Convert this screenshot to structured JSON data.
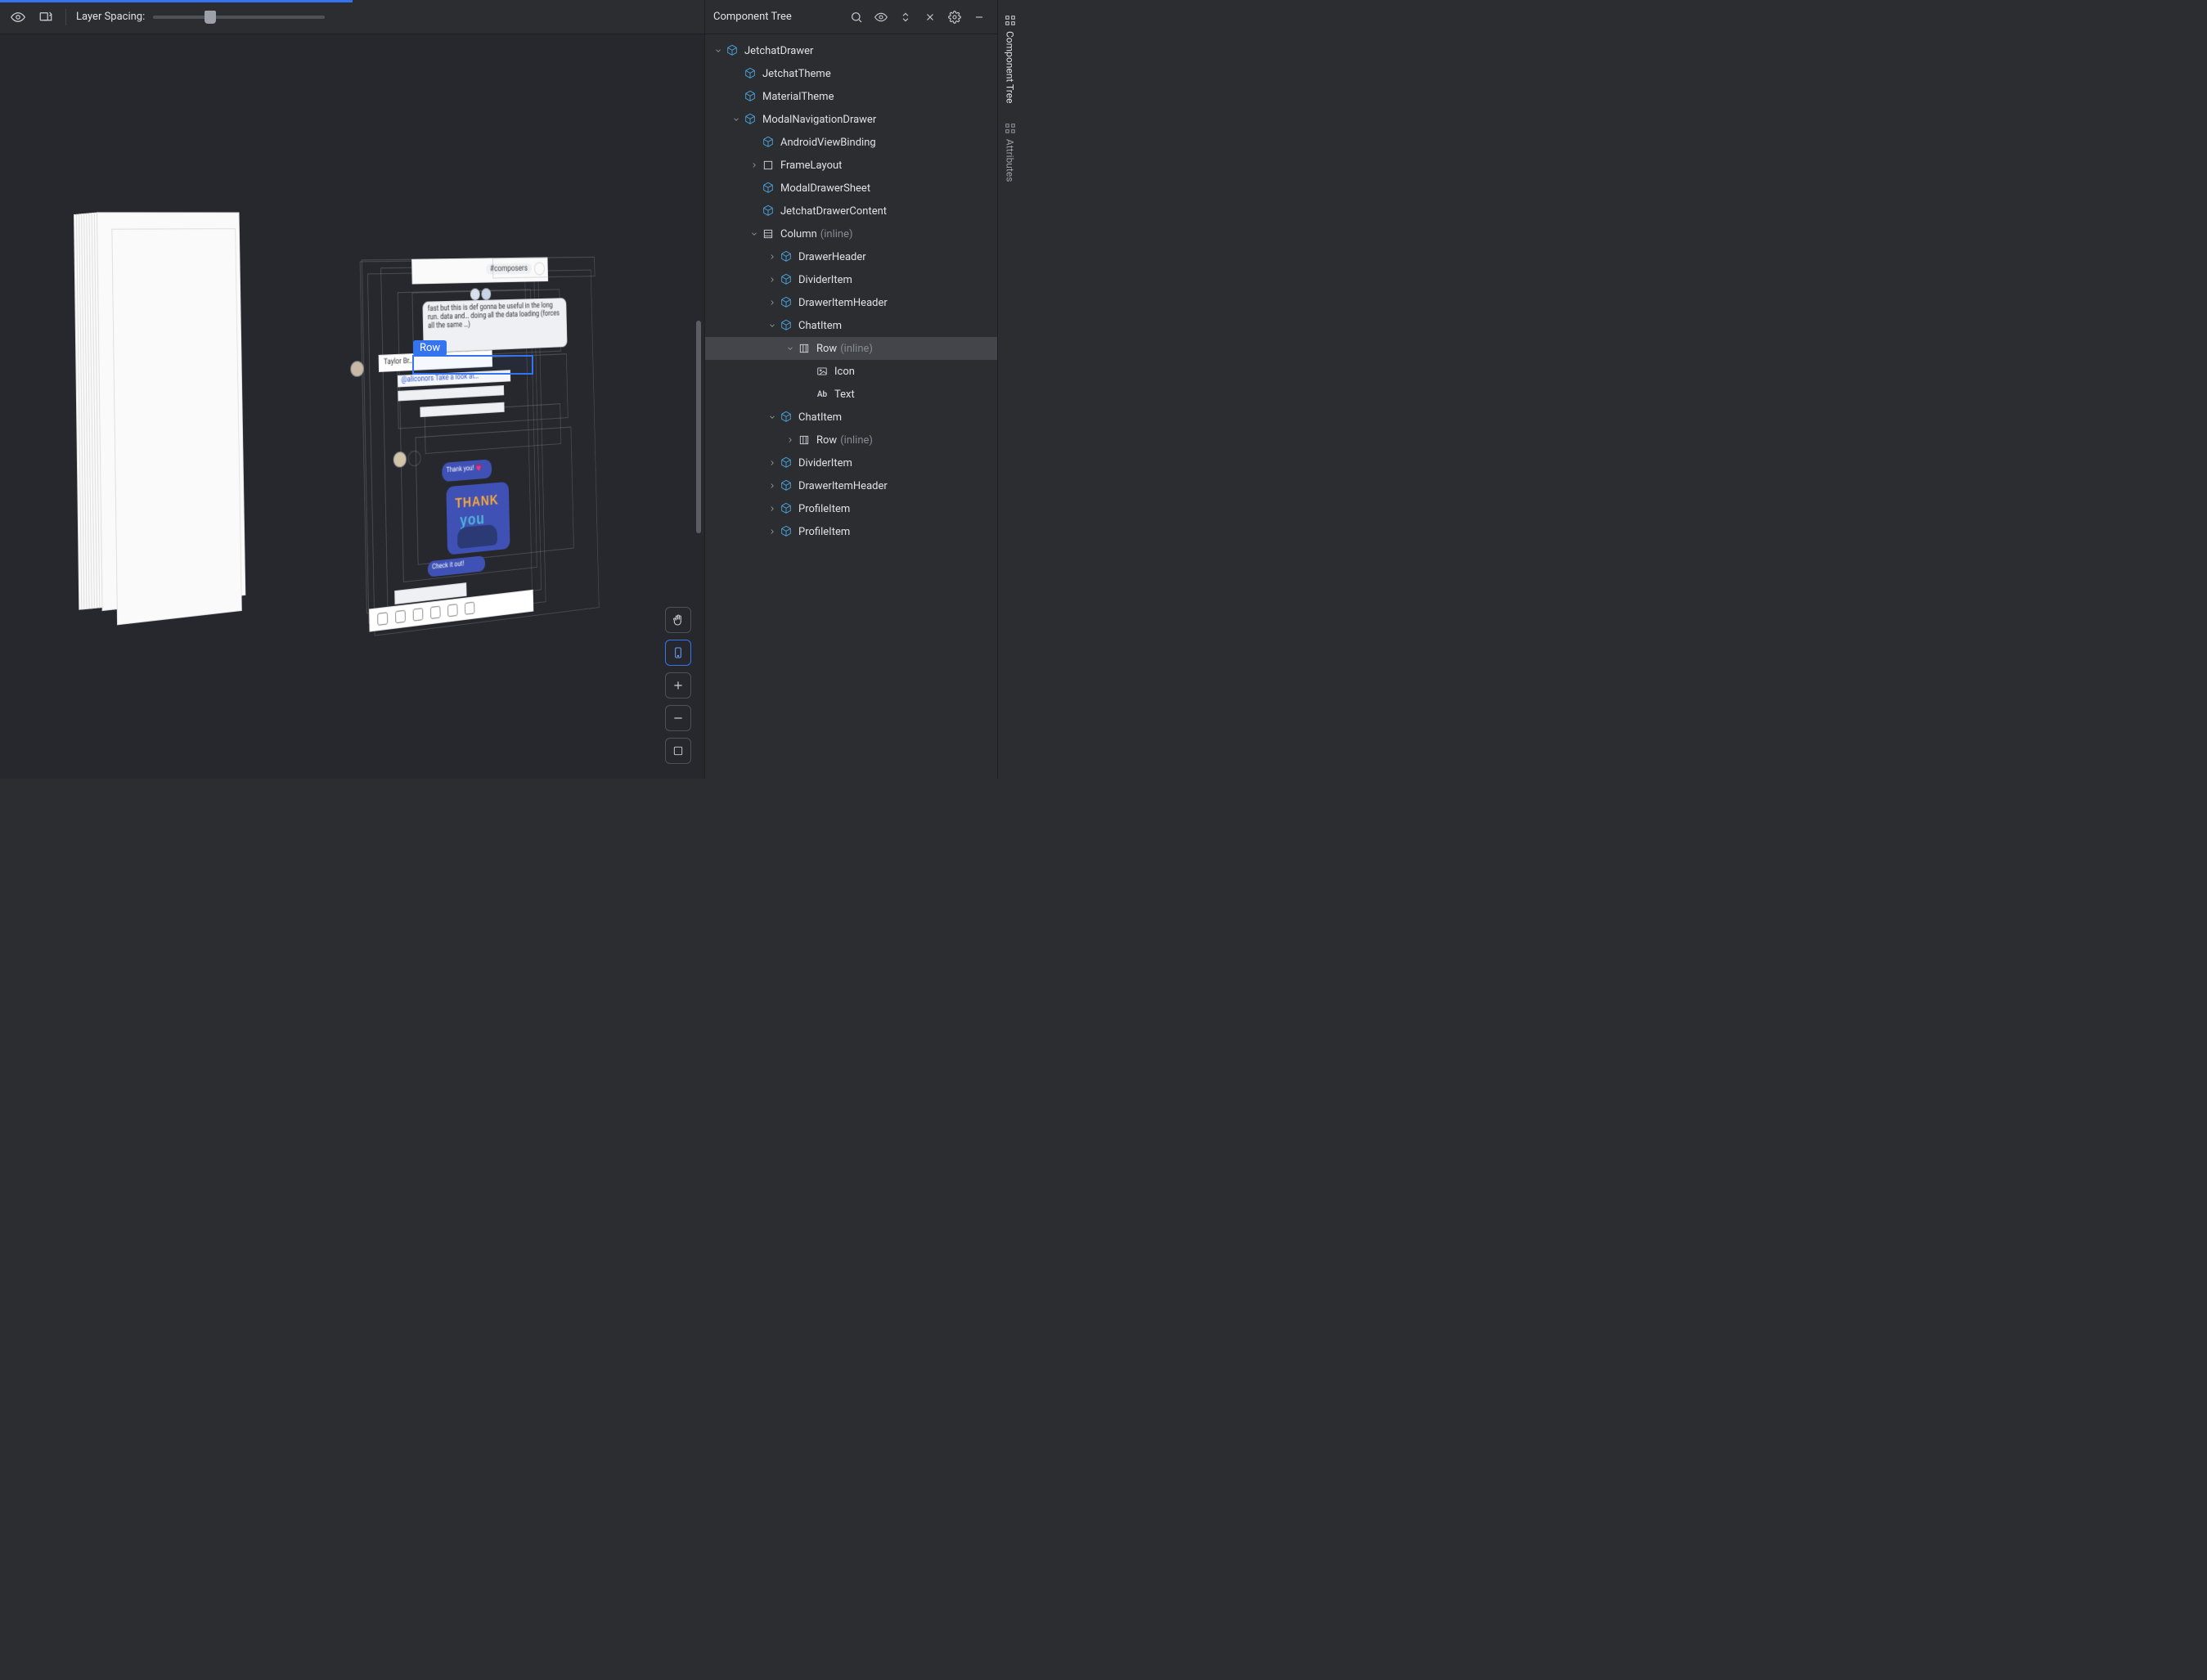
{
  "toolbar": {
    "layer_spacing_label": "Layer Spacing:"
  },
  "side": {
    "title": "Component Tree"
  },
  "tree": [
    {
      "depth": 0,
      "arrow": "down",
      "icon": "compose",
      "label": "JetchatDrawer"
    },
    {
      "depth": 1,
      "arrow": "none",
      "icon": "compose",
      "label": "JetchatTheme"
    },
    {
      "depth": 1,
      "arrow": "none",
      "icon": "compose",
      "label": "MaterialTheme"
    },
    {
      "depth": 1,
      "arrow": "down",
      "icon": "compose",
      "label": "ModalNavigationDrawer"
    },
    {
      "depth": 2,
      "arrow": "none",
      "icon": "compose",
      "label": "AndroidViewBinding"
    },
    {
      "depth": 2,
      "arrow": "right",
      "icon": "frame",
      "label": "FrameLayout"
    },
    {
      "depth": 2,
      "arrow": "none",
      "icon": "compose",
      "label": "ModalDrawerSheet"
    },
    {
      "depth": 2,
      "arrow": "none",
      "icon": "compose",
      "label": "JetchatDrawerContent"
    },
    {
      "depth": 2,
      "arrow": "down",
      "icon": "column",
      "label": "Column",
      "dim": "(inline)"
    },
    {
      "depth": 3,
      "arrow": "right",
      "icon": "compose",
      "label": "DrawerHeader",
      "guide": true
    },
    {
      "depth": 3,
      "arrow": "right",
      "icon": "compose",
      "label": "DividerItem",
      "guide": true
    },
    {
      "depth": 3,
      "arrow": "right",
      "icon": "compose",
      "label": "DrawerItemHeader",
      "guide": true
    },
    {
      "depth": 3,
      "arrow": "down",
      "icon": "compose",
      "label": "ChatItem",
      "guide": true
    },
    {
      "depth": 4,
      "arrow": "down",
      "icon": "row",
      "label": "Row",
      "dim": "(inline)",
      "selected": true,
      "guide": true
    },
    {
      "depth": 5,
      "arrow": "none",
      "icon": "image",
      "label": "Icon",
      "guide": true,
      "guideBranch": true
    },
    {
      "depth": 5,
      "arrow": "none",
      "icon": "text",
      "label": "Text",
      "guide": true,
      "guideBranch": true,
      "guideEnd": true
    },
    {
      "depth": 3,
      "arrow": "down",
      "icon": "compose",
      "label": "ChatItem",
      "guide": true
    },
    {
      "depth": 4,
      "arrow": "right",
      "icon": "row",
      "label": "Row",
      "dim": "(inline)",
      "guide": true
    },
    {
      "depth": 3,
      "arrow": "right",
      "icon": "compose",
      "label": "DividerItem",
      "guide": true
    },
    {
      "depth": 3,
      "arrow": "right",
      "icon": "compose",
      "label": "DrawerItemHeader",
      "guide": true
    },
    {
      "depth": 3,
      "arrow": "right",
      "icon": "compose",
      "label": "ProfileItem",
      "guide": true
    },
    {
      "depth": 3,
      "arrow": "right",
      "icon": "compose",
      "label": "ProfileItem",
      "guide": true,
      "guideEnd": true
    }
  ],
  "viewport": {
    "overlay_label": "Row",
    "app_header": "#composers",
    "msg1": "fast but this is def gonna be useful in the long run. data and… doing all the data loading (forces all the same …)",
    "author": "Taylor Br…",
    "mention": "@aliconors Take a look at…",
    "thankyou_small": "Thank you! 💗",
    "thankyou_big_top": "THANK",
    "thankyou_big_bottom": "you",
    "checkit": "Check it out!"
  },
  "rail": {
    "tab1": "Component Tree",
    "tab2": "Attributes"
  }
}
